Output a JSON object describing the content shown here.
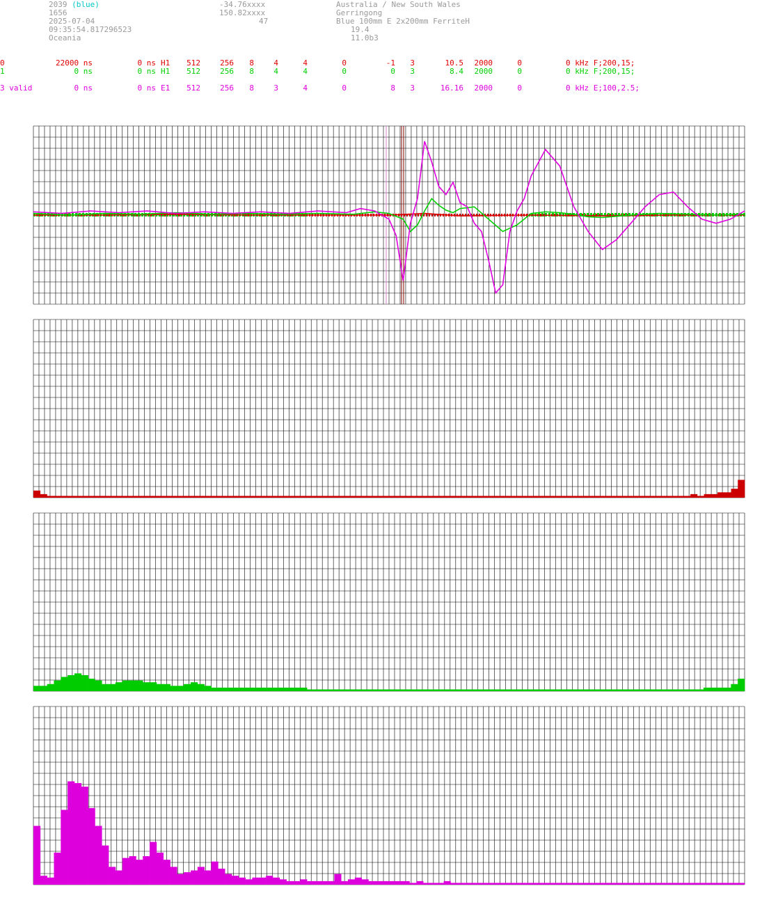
{
  "header": {
    "station_id": "2039",
    "station_color": "(blue)",
    "station_number": "1656",
    "date": "2025-07-04",
    "time": "09:35:54.817296523",
    "region": "Oceania",
    "latitude": "-34.76xxxx",
    "longitude": "150.82xxxx",
    "altitude": "47",
    "country": "Australia / New South Wales",
    "city": "Gerringong",
    "antenna": "Blue 100mm E 2x200mm FerriteH",
    "val1": "19.4",
    "val2": "11.0b3"
  },
  "channels": [
    {
      "id": "0",
      "delay": "22000 ns",
      "offset": "0 ns",
      "type": "H1",
      "n1": "512",
      "n2": "256",
      "n3": "8",
      "n4": "4",
      "n5": "4",
      "n6": "0",
      "n7": "-1",
      "n8": "3",
      "gain": "10.5",
      "rate": "2000",
      "z": "0",
      "filter": "0 kHz F;200,15;",
      "color": "#e00000"
    },
    {
      "id": "1",
      "delay": "0 ns",
      "offset": "0 ns",
      "type": "H1",
      "n1": "512",
      "n2": "256",
      "n3": "8",
      "n4": "4",
      "n5": "4",
      "n6": "0",
      "n7": "0",
      "n8": "3",
      "gain": "8.4",
      "rate": "2000",
      "z": "0",
      "filter": "0 kHz F;200,15;",
      "color": "#00d000"
    },
    {
      "id": "3 valid",
      "delay": "0 ns",
      "offset": "0 ns",
      "type": "E1",
      "n1": "512",
      "n2": "256",
      "n3": "8",
      "n4": "3",
      "n5": "4",
      "n6": "0",
      "n7": "8",
      "n8": "3",
      "gain": "16.16",
      "rate": "2000",
      "z": "0",
      "filter": "0 kHz E;100,2.5;",
      "color": "#e000e0"
    }
  ],
  "chart_data": [
    {
      "type": "line",
      "panel": "waveform",
      "ylim": [
        -1,
        1
      ],
      "grid": true,
      "series": [
        {
          "color": "#e000e0",
          "x": [
            0,
            4,
            8,
            12,
            16,
            20,
            24,
            28,
            32,
            36,
            40,
            44,
            46,
            48,
            50,
            51,
            52,
            53,
            54,
            55,
            56,
            57,
            58,
            59,
            60,
            61,
            62,
            63,
            64,
            65,
            66,
            67,
            68,
            69,
            70,
            72,
            74,
            76,
            78,
            80,
            82,
            84,
            86,
            88,
            90,
            92,
            94,
            96,
            98,
            100
          ],
          "y": [
            0.04,
            0.02,
            0.05,
            0.03,
            0.05,
            0.02,
            0.04,
            0.02,
            0.04,
            0.02,
            0.05,
            0.03,
            0.08,
            0.05,
            -0.05,
            -0.25,
            -0.8,
            -0.1,
            0.2,
            0.9,
            0.65,
            0.35,
            0.25,
            0.4,
            0.15,
            0.1,
            -0.1,
            -0.2,
            -0.55,
            -0.95,
            -0.85,
            -0.2,
            0.05,
            0.2,
            0.48,
            0.8,
            0.6,
            0.1,
            -0.2,
            -0.42,
            -0.3,
            -0.1,
            0.1,
            0.25,
            0.28,
            0.1,
            -0.05,
            -0.1,
            -0.05,
            0.05
          ]
        },
        {
          "color": "#00d000",
          "x": [
            0,
            5,
            10,
            15,
            20,
            25,
            30,
            35,
            40,
            45,
            48,
            50,
            52,
            53,
            54,
            55,
            56,
            57,
            58,
            59,
            60,
            62,
            64,
            66,
            68,
            70,
            72,
            74,
            76,
            78,
            80,
            84,
            88,
            92,
            96,
            100
          ],
          "y": [
            0.02,
            0.0,
            0.02,
            0.01,
            0.03,
            0.01,
            0.02,
            0.01,
            0.02,
            0.01,
            0.04,
            0.02,
            -0.05,
            -0.2,
            -0.12,
            0.05,
            0.2,
            0.12,
            0.06,
            0.03,
            0.08,
            0.1,
            -0.05,
            -0.2,
            -0.12,
            0.02,
            0.04,
            0.03,
            0.01,
            -0.02,
            -0.03,
            0.0,
            0.02,
            0.01,
            0.0,
            0.01
          ]
        },
        {
          "color": "#e00000",
          "x": [
            0,
            10,
            20,
            30,
            40,
            50,
            55,
            60,
            70,
            80,
            90,
            100
          ],
          "y": [
            0.0,
            0.0,
            0.01,
            0.0,
            0.0,
            0.0,
            0.02,
            -0.01,
            0.0,
            -0.01,
            0.0,
            0.0
          ]
        }
      ]
    },
    {
      "type": "bar",
      "panel": "spectrum-red",
      "color": "#cc0000",
      "ylim": [
        0,
        1
      ],
      "values": [
        0.04,
        0.02,
        0.01,
        0.01,
        0.01,
        0.01,
        0.01,
        0.01,
        0.01,
        0.01,
        0.01,
        0.01,
        0.01,
        0.01,
        0.01,
        0.01,
        0.01,
        0.01,
        0.01,
        0.01,
        0.01,
        0.01,
        0.01,
        0.01,
        0.01,
        0.01,
        0.01,
        0.01,
        0.01,
        0.01,
        0.01,
        0.01,
        0.01,
        0.01,
        0.01,
        0.01,
        0.01,
        0.01,
        0.01,
        0.01,
        0.01,
        0.01,
        0.01,
        0.01,
        0.01,
        0.01,
        0.01,
        0.01,
        0.01,
        0.01,
        0.01,
        0.01,
        0.01,
        0.01,
        0.01,
        0.01,
        0.01,
        0.01,
        0.01,
        0.01,
        0.01,
        0.01,
        0.01,
        0.01,
        0.01,
        0.01,
        0.01,
        0.01,
        0.01,
        0.01,
        0.01,
        0.01,
        0.01,
        0.01,
        0.01,
        0.01,
        0.01,
        0.01,
        0.01,
        0.01,
        0.01,
        0.01,
        0.01,
        0.01,
        0.01,
        0.01,
        0.01,
        0.01,
        0.01,
        0.01,
        0.01,
        0.01,
        0.01,
        0.01,
        0.01,
        0.01,
        0.01,
        0.02,
        0.01,
        0.02,
        0.02,
        0.03,
        0.03,
        0.05,
        0.1
      ]
    },
    {
      "type": "bar",
      "panel": "spectrum-green",
      "color": "#00cc00",
      "ylim": [
        0,
        1
      ],
      "values": [
        0.03,
        0.03,
        0.04,
        0.06,
        0.08,
        0.09,
        0.1,
        0.09,
        0.07,
        0.06,
        0.04,
        0.04,
        0.05,
        0.06,
        0.06,
        0.06,
        0.05,
        0.05,
        0.04,
        0.04,
        0.03,
        0.03,
        0.04,
        0.05,
        0.04,
        0.03,
        0.02,
        0.02,
        0.02,
        0.02,
        0.02,
        0.02,
        0.02,
        0.02,
        0.02,
        0.02,
        0.02,
        0.02,
        0.02,
        0.02,
        0.01,
        0.01,
        0.01,
        0.01,
        0.01,
        0.01,
        0.01,
        0.01,
        0.01,
        0.01,
        0.01,
        0.01,
        0.01,
        0.01,
        0.01,
        0.01,
        0.01,
        0.01,
        0.01,
        0.01,
        0.01,
        0.01,
        0.01,
        0.01,
        0.01,
        0.01,
        0.01,
        0.01,
        0.01,
        0.01,
        0.01,
        0.01,
        0.01,
        0.01,
        0.01,
        0.01,
        0.01,
        0.01,
        0.01,
        0.01,
        0.01,
        0.01,
        0.01,
        0.01,
        0.01,
        0.01,
        0.01,
        0.01,
        0.01,
        0.01,
        0.01,
        0.01,
        0.01,
        0.01,
        0.01,
        0.01,
        0.01,
        0.01,
        0.02,
        0.02,
        0.02,
        0.02,
        0.04,
        0.07
      ]
    },
    {
      "type": "bar",
      "panel": "spectrum-magenta",
      "color": "#dd00dd",
      "ylim": [
        0,
        1
      ],
      "values": [
        0.33,
        0.05,
        0.04,
        0.18,
        0.42,
        0.58,
        0.57,
        0.55,
        0.43,
        0.33,
        0.22,
        0.1,
        0.08,
        0.15,
        0.16,
        0.14,
        0.16,
        0.24,
        0.18,
        0.14,
        0.1,
        0.06,
        0.07,
        0.08,
        0.1,
        0.08,
        0.13,
        0.09,
        0.06,
        0.05,
        0.04,
        0.03,
        0.04,
        0.04,
        0.05,
        0.04,
        0.03,
        0.02,
        0.02,
        0.03,
        0.02,
        0.02,
        0.02,
        0.02,
        0.06,
        0.02,
        0.03,
        0.04,
        0.03,
        0.02,
        0.02,
        0.02,
        0.02,
        0.02,
        0.02,
        0.01,
        0.02,
        0.01,
        0.01,
        0.01,
        0.02,
        0.01,
        0.01,
        0.01,
        0.01,
        0.01,
        0.01,
        0.01,
        0.01,
        0.01,
        0.01,
        0.01,
        0.01,
        0.01,
        0.01,
        0.01,
        0.01,
        0.01,
        0.01,
        0.01,
        0.01,
        0.01,
        0.01,
        0.01,
        0.01,
        0.01,
        0.01,
        0.01,
        0.01,
        0.01,
        0.01,
        0.01,
        0.01,
        0.01,
        0.01,
        0.01,
        0.01,
        0.01,
        0.01,
        0.01,
        0.01,
        0.01,
        0.01,
        0.01
      ]
    }
  ]
}
